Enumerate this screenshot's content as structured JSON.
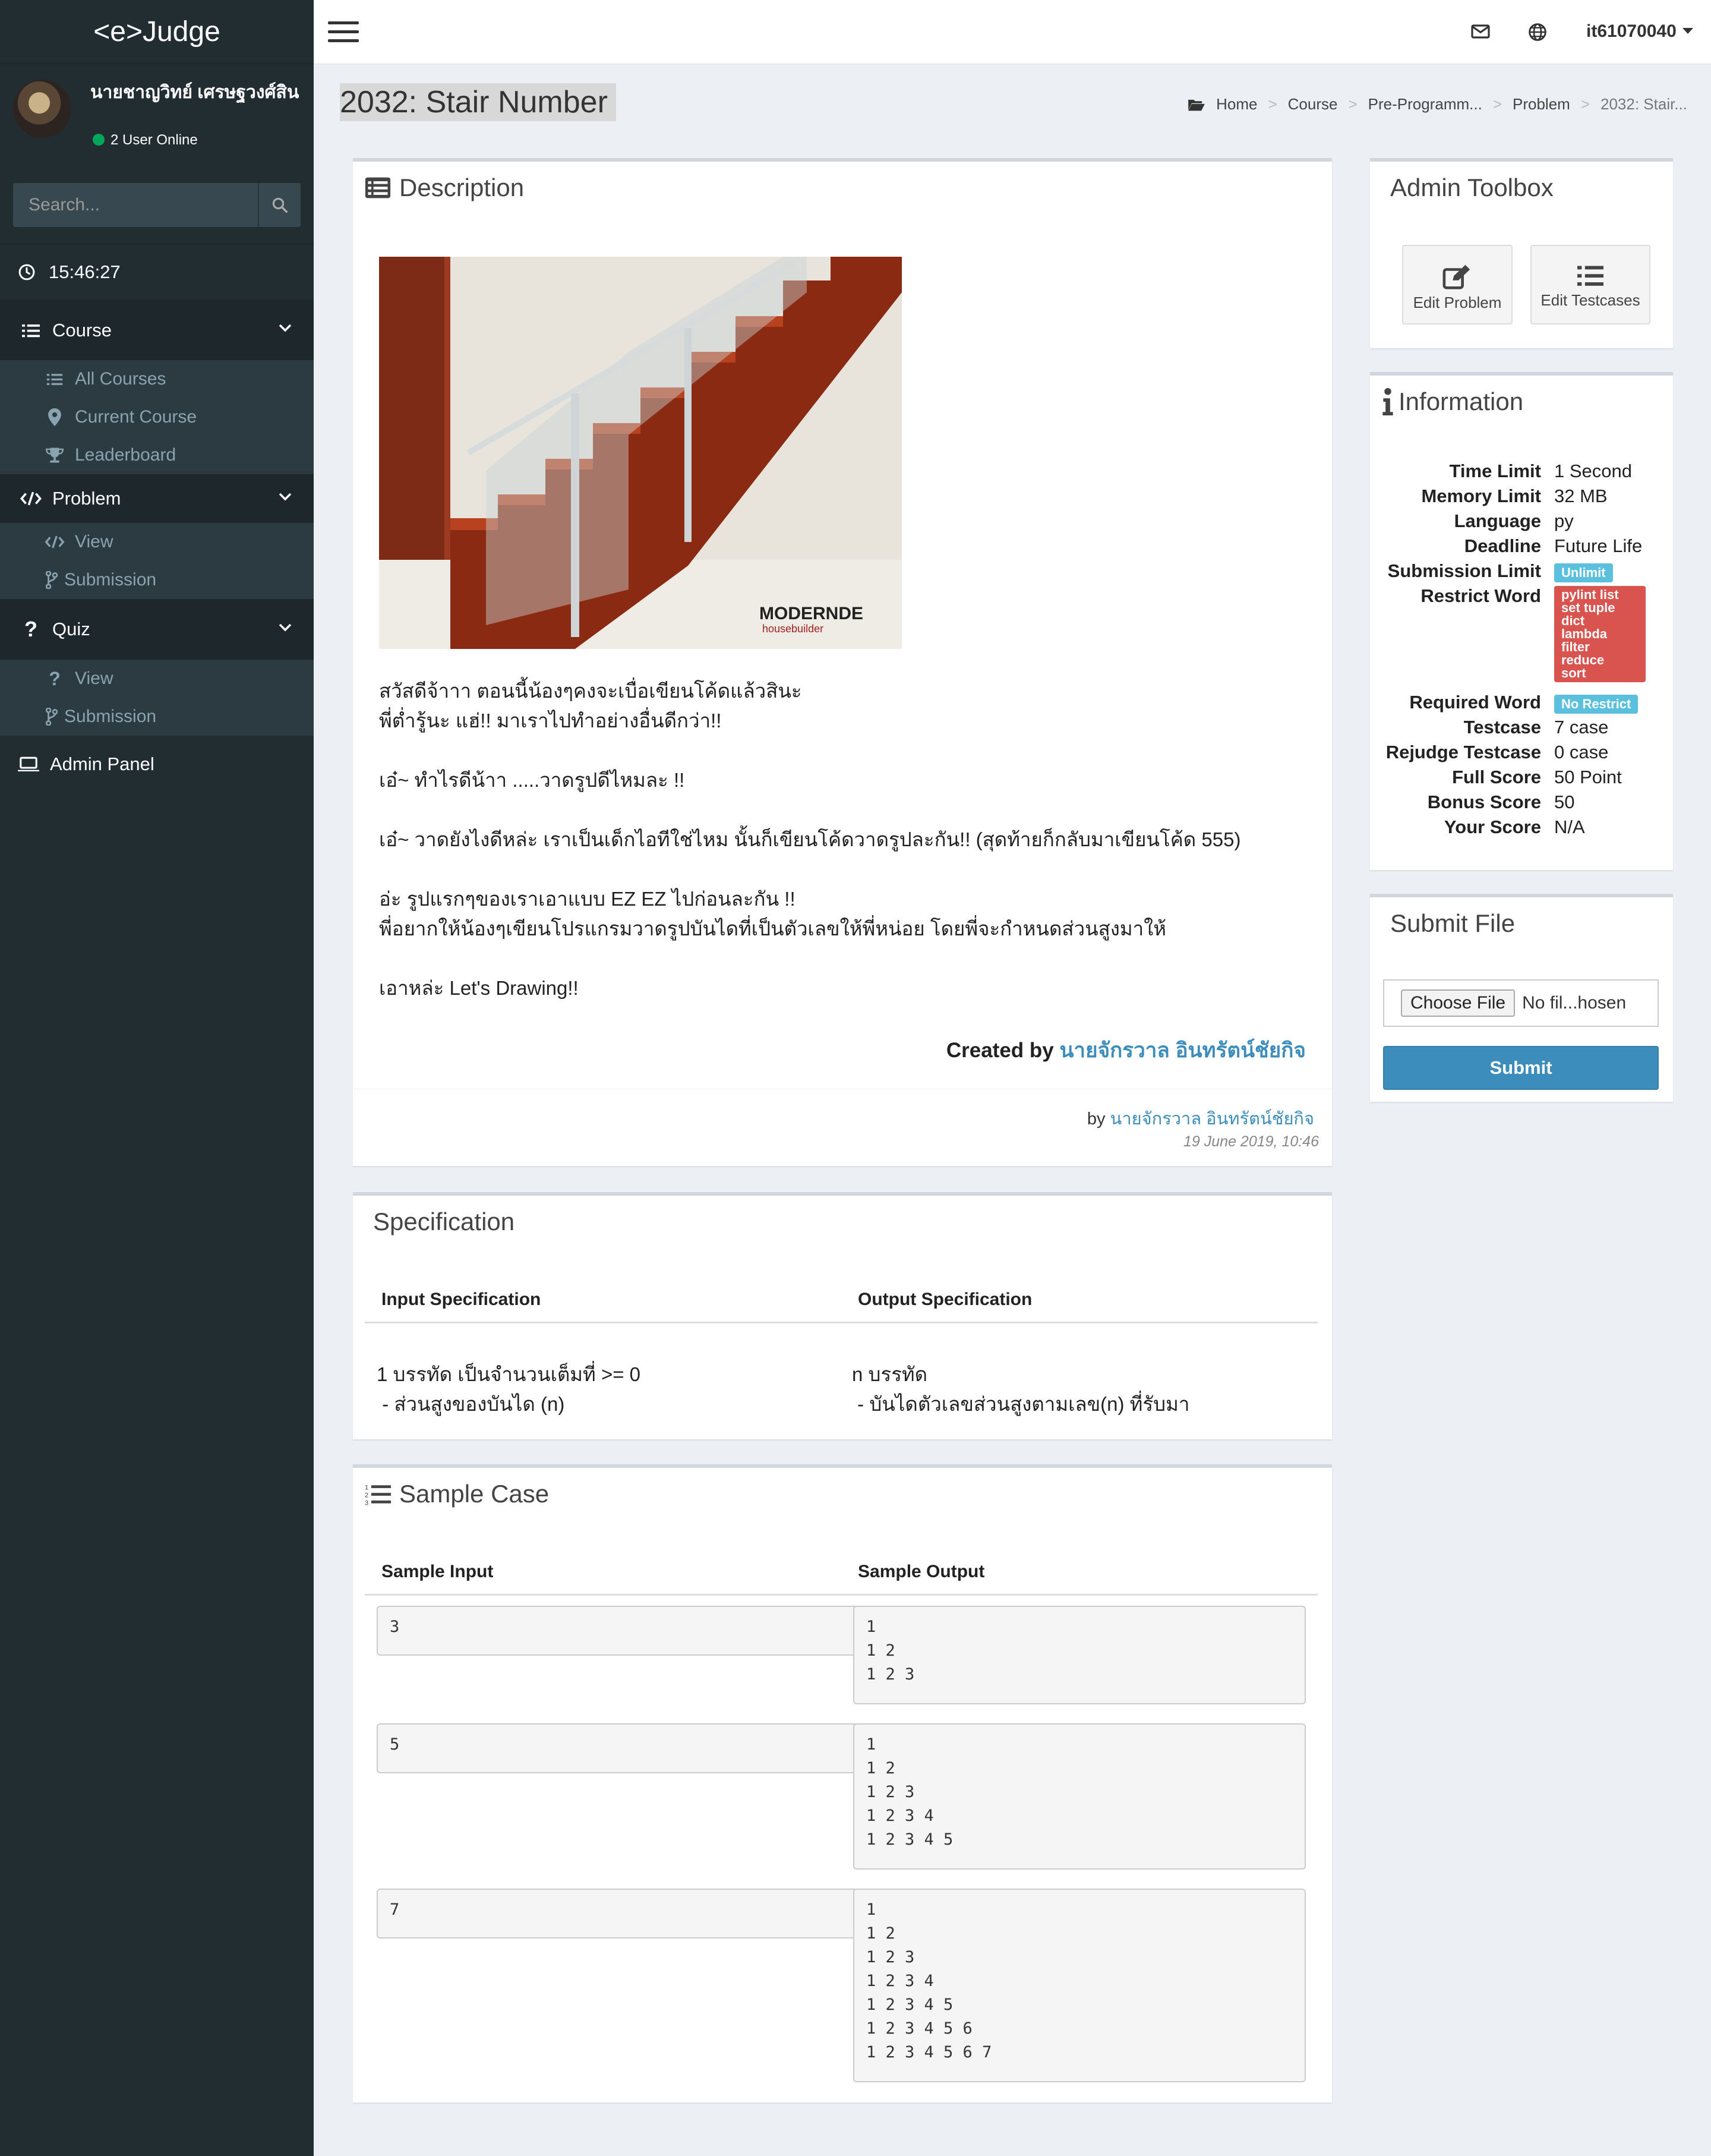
{
  "app": {
    "logo": "<e>Judge"
  },
  "user_panel": {
    "name": "นายชาญวิทย์ เศรษฐวงศ์สิน",
    "online": "2 User Online"
  },
  "search": {
    "placeholder": "Search..."
  },
  "clock": "15:46:27",
  "sidebar": {
    "course": {
      "label": "Course",
      "items": [
        "All Courses",
        "Current Course",
        "Leaderboard"
      ]
    },
    "problem": {
      "label": "Problem",
      "items": [
        "View",
        "Submission"
      ]
    },
    "quiz": {
      "label": "Quiz",
      "items": [
        "View",
        "Submission"
      ]
    },
    "admin": "Admin Panel"
  },
  "topbar": {
    "username": "it61070040"
  },
  "page": {
    "title": "2032: Stair Number"
  },
  "breadcrumb": [
    "Home",
    "Course",
    "Pre-Programm...",
    "Problem",
    "2032: Stair..."
  ],
  "description": {
    "title": "Description",
    "image_watermark": "MODERNDE housebuilder",
    "paragraphs": [
      [
        "สวัสดีจ้าาา ตอนนี้น้องๆคงจะเบื่อเขียนโค้ดแล้วสินะ",
        "พี่ต่ำรู้นะ แฮ่!! มาเราไปทำอย่างอื่นดีกว่า!!"
      ],
      [
        "เอ๋~ ทำไรดีน้าา .....วาดรูปดีไหมละ !!"
      ],
      [
        "เอ๋~ วาดยังไงดีหล่ะ เราเป็นเด็กไอทีใช่ไหม นั้นก็เขียนโค้ดวาดรูปละกัน!! (สุดท้ายก็กลับมาเขียนโค้ด 555)"
      ],
      [
        "อ่ะ รูปแรกๆของเราเอาแบบ EZ EZ ไปก่อนละกัน !!",
        "พี่อยากให้น้องๆเขียนโปรแกรมวาดรูปบันไดที่เป็นตัวเลขให้พี่หน่อย โดยพี่จะกำหนดส่วนสูงมาให้"
      ],
      [
        "เอาหล่ะ Let's Drawing!!"
      ]
    ],
    "created_by_label": "Created by",
    "author": "นายจักรวาล อินทรัตน์ชัยกิจ",
    "footer_by": "by",
    "footer_author": "นายจักรวาล อินทรัตน์ชัยกิจ",
    "footer_date": "19 June 2019, 10:46"
  },
  "specification": {
    "title": "Specification",
    "input_header": "Input Specification",
    "output_header": "Output Specification",
    "input_lines": [
      "1 บรรทัด เป็นจำนวนเต็มที่ >= 0",
      " - ส่วนสูงของบันได (n)"
    ],
    "output_lines": [
      "n บรรทัด",
      " - บันไดตัวเลขส่วนสูงตามเลข(n) ที่รับมา"
    ]
  },
  "samples": {
    "title": "Sample Case",
    "input_header": "Sample Input",
    "output_header": "Sample Output",
    "cases": [
      {
        "input": "3",
        "output": "1\n1 2\n1 2 3"
      },
      {
        "input": "5",
        "output": "1\n1 2\n1 2 3\n1 2 3 4\n1 2 3 4 5"
      },
      {
        "input": "7",
        "output": "1\n1 2\n1 2 3\n1 2 3 4\n1 2 3 4 5\n1 2 3 4 5 6\n1 2 3 4 5 6 7"
      }
    ]
  },
  "admin_toolbox": {
    "title": "Admin Toolbox",
    "edit_problem": "Edit Problem",
    "edit_testcases": "Edit Testcases"
  },
  "information": {
    "title": "Information",
    "time_limit_label": "Time Limit",
    "time_limit": "1 Second",
    "memory_limit_label": "Memory Limit",
    "memory_limit": "32 MB",
    "language_label": "Language",
    "language": "py",
    "deadline_label": "Deadline",
    "deadline": "Future Life",
    "submission_limit_label": "Submission Limit",
    "submission_limit": "Unlimit",
    "restrict_word_label": "Restrict Word",
    "restrict_words": [
      "pylint list",
      "set tuple",
      "dict",
      "lambda",
      "filter",
      "reduce",
      "sort"
    ],
    "required_word_label": "Required Word",
    "required_word": "No Restrict",
    "testcase_label": "Testcase",
    "testcase": "7 case",
    "rejudge_label": "Rejudge Testcase",
    "rejudge": "0 case",
    "full_score_label": "Full Score",
    "full_score": "50 Point",
    "bonus_score_label": "Bonus Score",
    "bonus_score": "50",
    "your_score_label": "Your Score",
    "your_score": "N/A"
  },
  "submit_file": {
    "title": "Submit File",
    "choose_file": "Choose File",
    "no_file": "No fil...hosen",
    "submit": "Submit"
  },
  "colors": {
    "sidebar": "#222d32",
    "accent": "#3c8dbc",
    "info_badge": "#5bc0de",
    "danger_badge": "#d9534f",
    "online": "#00a65a"
  }
}
